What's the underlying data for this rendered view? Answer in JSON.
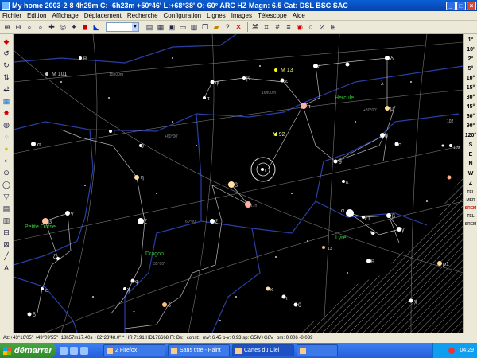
{
  "window": {
    "title": "My home 2003-2-8   4h29m C: -6h23m +50°46' L:+68°38' O:-60° ARC HZ  Magn: 6.5 Cat: DSL BSC SAC"
  },
  "menu": [
    "Fichier",
    "Edition",
    "Affichage",
    "Déplacement",
    "Recherche",
    "Configuration",
    "Lignes",
    "Images",
    "Télescope",
    "Aide"
  ],
  "right_toolbar": [
    "1°",
    "10'",
    "2°",
    "5°",
    "10°",
    "15°",
    "30°",
    "45°",
    "60°",
    "90°",
    "120°",
    "S",
    "E",
    "N",
    "W",
    "Z",
    "TEL",
    "MER",
    "SREM",
    "TEL",
    "SREM"
  ],
  "sky_labels": {
    "m101": "M 101",
    "m13": "M 13",
    "m92": "M 92",
    "hercule": "Hercule",
    "dragon": "Dragon",
    "petite_ourse": "Petite Ourse",
    "lyre": "Lyre",
    "ra_15h": "15h00m",
    "ra_16h": "16h00m",
    "dec_30": "+30°00'",
    "dec_60": "+60°00'",
    "dec_60b": "60°00'",
    "dec_35": "35°00'",
    "ra_17h": "17h",
    "num_13": "13",
    "num_102": "102",
    "num_109": "109",
    "greek": {
      "theta": "θ",
      "eta": "η",
      "zeta": "ζ",
      "iota": "ι",
      "alpha": "α",
      "beta": "β",
      "gamma": "γ",
      "epsilon": "ε",
      "delta": "δ",
      "kappa": "κ",
      "phi": "φ",
      "tau": "τ",
      "pi": "π",
      "mu": "μ",
      "lambda": "λ",
      "omicron": "ο",
      "chi": "χ",
      "rho1": "ρ1",
      "delta2": "δ2",
      "epsilon1": "ε1",
      "nu2": "ν2",
      "xi": "ξ",
      "upsilon": "υ"
    }
  },
  "status": {
    "coord": "Az:+43°16'05\" +49°09'55\"",
    "object": "18h57m17.40s +62°23'48.0\"  * HR 7191 HD176668 Fl:   Bs:",
    "const": "const:",
    "mag": "mV: 6.45 b-v: 0.93 sp: G5IV+G8V",
    "pm": "pm: 0.006 -0.039"
  },
  "taskbar": {
    "start": "démarrer",
    "tasks": [
      "2 Firefox",
      "Sans titre - Paint",
      "Cartes du Ciel",
      ""
    ],
    "clock": "04:29"
  }
}
